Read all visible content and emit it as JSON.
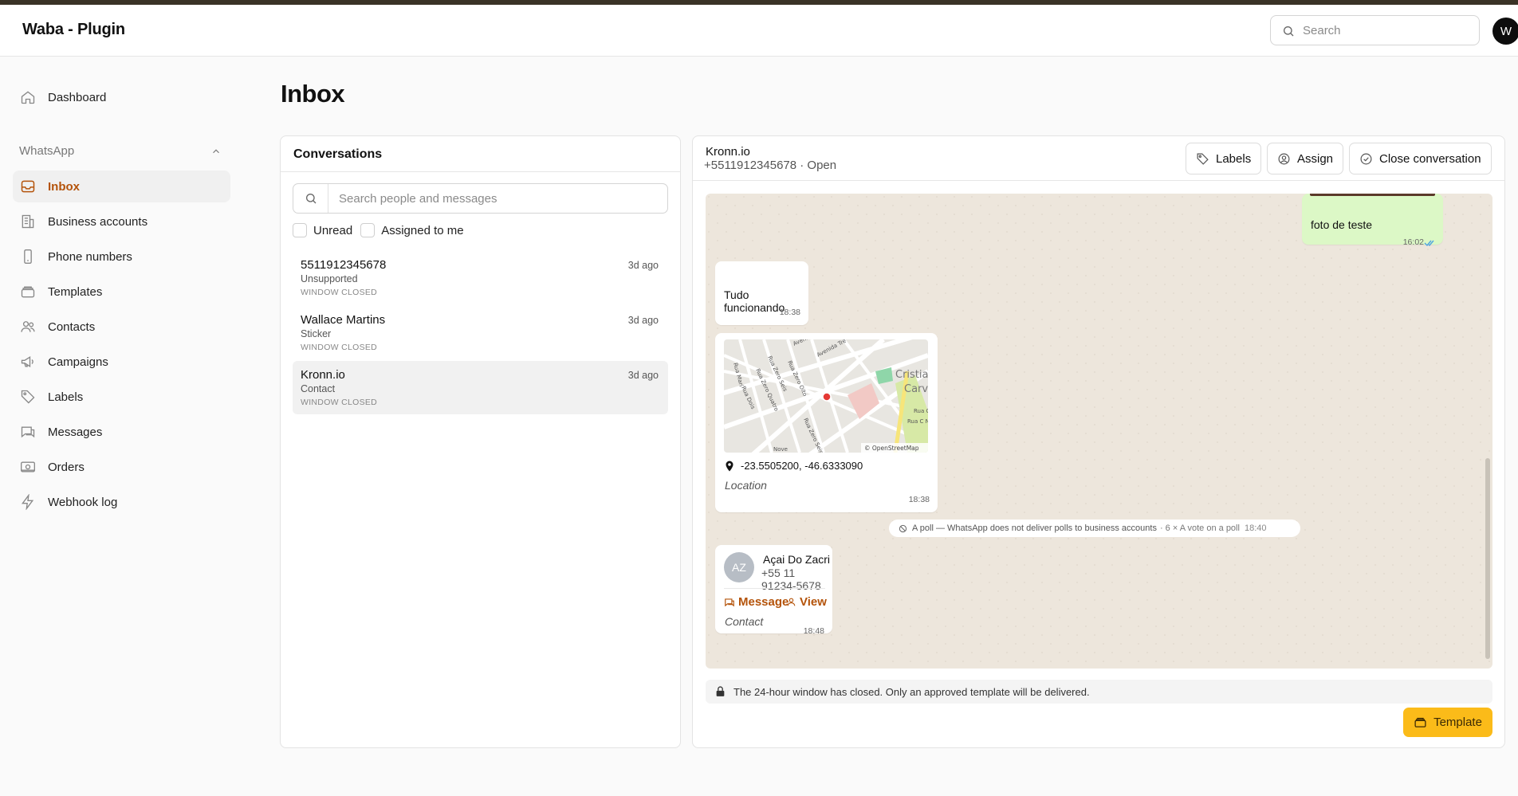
{
  "app": {
    "title": "Waba - Plugin",
    "user_initial": "W"
  },
  "global_search": {
    "placeholder": "Search"
  },
  "sidebar": {
    "dashboard": "Dashboard",
    "group_label": "WhatsApp",
    "items": [
      {
        "label": "Inbox",
        "icon": "inbox-icon",
        "active": true
      },
      {
        "label": "Business accounts",
        "icon": "building-icon"
      },
      {
        "label": "Phone numbers",
        "icon": "phone-icon"
      },
      {
        "label": "Templates",
        "icon": "layers-icon"
      },
      {
        "label": "Contacts",
        "icon": "users-icon"
      },
      {
        "label": "Campaigns",
        "icon": "megaphone-icon"
      },
      {
        "label": "Labels",
        "icon": "tag-icon"
      },
      {
        "label": "Messages",
        "icon": "chat-icon"
      },
      {
        "label": "Orders",
        "icon": "orders-icon"
      },
      {
        "label": "Webhook log",
        "icon": "bolt-icon"
      }
    ]
  },
  "page": {
    "title": "Inbox"
  },
  "conversations": {
    "title": "Conversations",
    "search_placeholder": "Search people and messages",
    "filter_unread": "Unread",
    "filter_assigned": "Assigned to me",
    "items": [
      {
        "name": "5511912345678",
        "preview": "Unsupported",
        "status": "WINDOW CLOSED",
        "time": "3d ago"
      },
      {
        "name": "Wallace Martins",
        "preview": "Sticker",
        "status": "WINDOW CLOSED",
        "time": "3d ago"
      },
      {
        "name": "Kronn.io",
        "preview": "Contact",
        "status": "WINDOW CLOSED",
        "time": "3d ago",
        "selected": true
      }
    ]
  },
  "chat": {
    "name": "Kronn.io",
    "meta": "+5511912345678 · Open",
    "labels_button": "Labels",
    "assign_button": "Assign",
    "close_button": "Close conversation",
    "messages": {
      "outgoing_caption": "foto de teste",
      "outgoing_time": "16:02",
      "text": "Tudo funcionando",
      "text_time": "18:38",
      "location_coords": "-23.5505200, -46.6333090",
      "location_label": "Location",
      "location_time": "18:38",
      "map_attribution": "© OpenStreetMap",
      "poll_notice": "A poll — WhatsApp does not deliver polls to business accounts",
      "poll_detail": "· 6 × A vote on a poll",
      "poll_time": "18:40",
      "contact_initials": "AZ",
      "contact_name": "Açai Do Zacri",
      "contact_phone": "+55 11 91234-5678",
      "contact_message": "Message",
      "contact_view": "View",
      "contact_label": "Contact",
      "contact_time": "18:48"
    },
    "window_notice": "The 24-hour window has closed. Only an approved template will be delivered.",
    "template_button": "Template"
  },
  "map_labels": [
    "Rua Marí",
    "Rua Zero Seis",
    "Rua Zero Quatro",
    "Rua Dois",
    "Rua Zero Oito",
    "Avenida Trê",
    "Avenid",
    "Cristia",
    "Carv",
    "Rua C",
    "Rua C N",
    "Rua Zero Seis",
    "Nove"
  ],
  "colors": {
    "accent": "#b4530a",
    "template_button": "#fbbb19",
    "chat_bg": "#ede6dc",
    "outgoing_bubble": "#dcf8c6"
  }
}
